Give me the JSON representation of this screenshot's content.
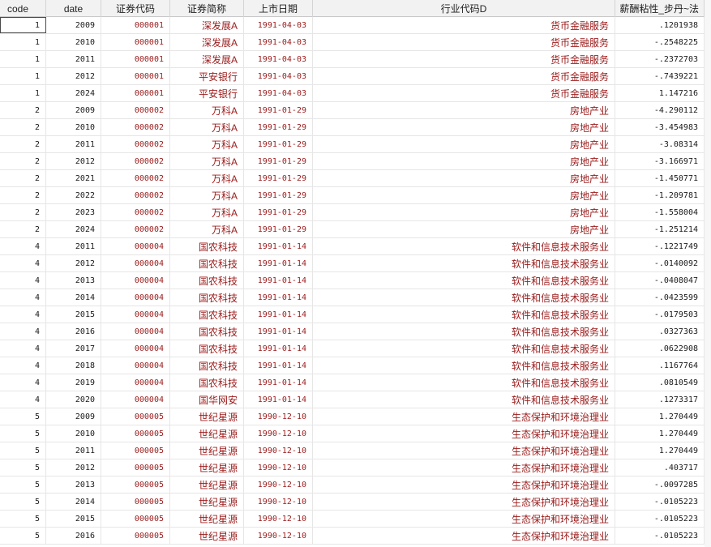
{
  "headers": [
    "code",
    "date",
    "证券代码",
    "证券简称",
    "上市日期",
    "行业代码D",
    "薪酬粘性_步丹~法"
  ],
  "rows": [
    [
      "1",
      "2009",
      "000001",
      "深发展A",
      "1991-04-03",
      "货币金融服务",
      ".1201938"
    ],
    [
      "1",
      "2010",
      "000001",
      "深发展A",
      "1991-04-03",
      "货币金融服务",
      "-.2548225"
    ],
    [
      "1",
      "2011",
      "000001",
      "深发展A",
      "1991-04-03",
      "货币金融服务",
      "-.2372703"
    ],
    [
      "1",
      "2012",
      "000001",
      "平安银行",
      "1991-04-03",
      "货币金融服务",
      "-.7439221"
    ],
    [
      "1",
      "2024",
      "000001",
      "平安银行",
      "1991-04-03",
      "货币金融服务",
      "1.147216"
    ],
    [
      "2",
      "2009",
      "000002",
      "万科A",
      "1991-01-29",
      "房地产业",
      "-4.290112"
    ],
    [
      "2",
      "2010",
      "000002",
      "万科A",
      "1991-01-29",
      "房地产业",
      "-3.454983"
    ],
    [
      "2",
      "2011",
      "000002",
      "万科A",
      "1991-01-29",
      "房地产业",
      "-3.08314"
    ],
    [
      "2",
      "2012",
      "000002",
      "万科A",
      "1991-01-29",
      "房地产业",
      "-3.166971"
    ],
    [
      "2",
      "2021",
      "000002",
      "万科A",
      "1991-01-29",
      "房地产业",
      "-1.450771"
    ],
    [
      "2",
      "2022",
      "000002",
      "万科A",
      "1991-01-29",
      "房地产业",
      "-1.209781"
    ],
    [
      "2",
      "2023",
      "000002",
      "万科A",
      "1991-01-29",
      "房地产业",
      "-1.558004"
    ],
    [
      "2",
      "2024",
      "000002",
      "万科A",
      "1991-01-29",
      "房地产业",
      "-1.251214"
    ],
    [
      "4",
      "2011",
      "000004",
      "国农科技",
      "1991-01-14",
      "软件和信息技术服务业",
      "-.1221749"
    ],
    [
      "4",
      "2012",
      "000004",
      "国农科技",
      "1991-01-14",
      "软件和信息技术服务业",
      "-.0140092"
    ],
    [
      "4",
      "2013",
      "000004",
      "国农科技",
      "1991-01-14",
      "软件和信息技术服务业",
      "-.0408047"
    ],
    [
      "4",
      "2014",
      "000004",
      "国农科技",
      "1991-01-14",
      "软件和信息技术服务业",
      "-.0423599"
    ],
    [
      "4",
      "2015",
      "000004",
      "国农科技",
      "1991-01-14",
      "软件和信息技术服务业",
      "-.0179503"
    ],
    [
      "4",
      "2016",
      "000004",
      "国农科技",
      "1991-01-14",
      "软件和信息技术服务业",
      ".0327363"
    ],
    [
      "4",
      "2017",
      "000004",
      "国农科技",
      "1991-01-14",
      "软件和信息技术服务业",
      ".0622908"
    ],
    [
      "4",
      "2018",
      "000004",
      "国农科技",
      "1991-01-14",
      "软件和信息技术服务业",
      ".1167764"
    ],
    [
      "4",
      "2019",
      "000004",
      "国农科技",
      "1991-01-14",
      "软件和信息技术服务业",
      ".0810549"
    ],
    [
      "4",
      "2020",
      "000004",
      "国华网安",
      "1991-01-14",
      "软件和信息技术服务业",
      ".1273317"
    ],
    [
      "5",
      "2009",
      "000005",
      "世纪星源",
      "1990-12-10",
      "生态保护和环境治理业",
      "1.270449"
    ],
    [
      "5",
      "2010",
      "000005",
      "世纪星源",
      "1990-12-10",
      "生态保护和环境治理业",
      "1.270449"
    ],
    [
      "5",
      "2011",
      "000005",
      "世纪星源",
      "1990-12-10",
      "生态保护和环境治理业",
      "1.270449"
    ],
    [
      "5",
      "2012",
      "000005",
      "世纪星源",
      "1990-12-10",
      "生态保护和环境治理业",
      ".403717"
    ],
    [
      "5",
      "2013",
      "000005",
      "世纪星源",
      "1990-12-10",
      "生态保护和环境治理业",
      "-.0097285"
    ],
    [
      "5",
      "2014",
      "000005",
      "世纪星源",
      "1990-12-10",
      "生态保护和环境治理业",
      "-.0105223"
    ],
    [
      "5",
      "2015",
      "000005",
      "世纪星源",
      "1990-12-10",
      "生态保护和环境治理业",
      "-.0105223"
    ],
    [
      "5",
      "2016",
      "000005",
      "世纪星源",
      "1990-12-10",
      "生态保护和环境治理业",
      "-.0105223"
    ]
  ],
  "colors": {
    "string_text": "#9b1b1b",
    "numeric_text": "#1a1a1a",
    "header_bg": "#f2f2f2"
  }
}
